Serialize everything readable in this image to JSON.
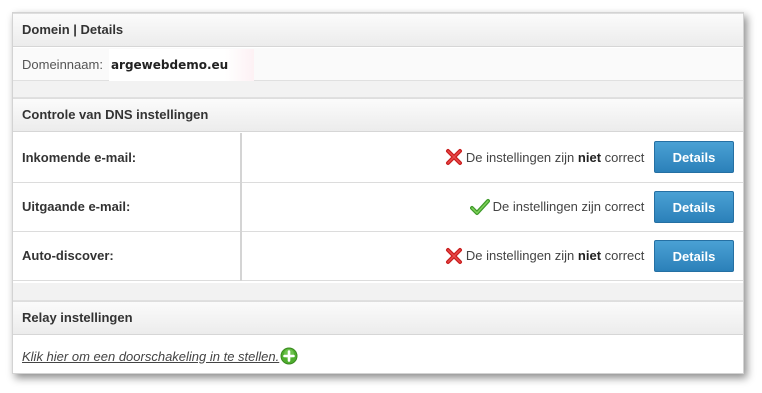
{
  "domain_section": {
    "header": "Domein | Details",
    "label": "Domeinnaam:",
    "value": "argewebdemo.eu"
  },
  "dns_section": {
    "header": "Controle van DNS instellingen",
    "rows": [
      {
        "name": "Inkomende e-mail:",
        "status_prefix": "De instellingen zijn ",
        "status_emphasis": "niet",
        "status_suffix": " correct",
        "status_icon": "red-x-icon",
        "ok": false,
        "button": "Details"
      },
      {
        "name": "Uitgaande e-mail:",
        "status_prefix": "De instellingen zijn correct",
        "status_emphasis": "",
        "status_suffix": "",
        "status_icon": "green-check-icon",
        "ok": true,
        "button": "Details"
      },
      {
        "name": "Auto-discover:",
        "status_prefix": "De instellingen zijn ",
        "status_emphasis": "niet",
        "status_suffix": " correct",
        "status_icon": "red-x-icon",
        "ok": false,
        "button": "Details"
      }
    ]
  },
  "relay_section": {
    "header": "Relay instellingen",
    "link_text": "Klik hier om een doorschakeling in te stellen.",
    "link_icon": "add-circle-icon"
  },
  "colors": {
    "button": "#2b80b9",
    "error": "#cc2222",
    "success": "#5fb83a"
  }
}
